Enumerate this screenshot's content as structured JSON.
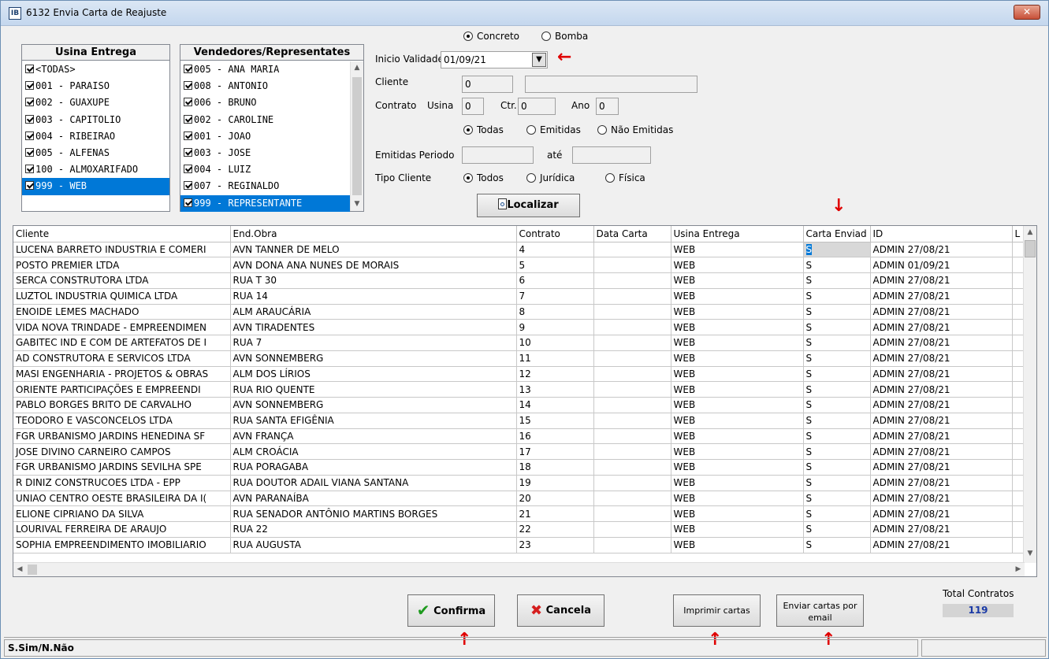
{
  "window": {
    "title": "6132 Envia Carta de Reajuste",
    "icon_text": "IB",
    "close_label": "✕"
  },
  "usina_panel": {
    "header": "Usina Entrega",
    "items": [
      {
        "label": "<TODAS>",
        "checked": true
      },
      {
        "label": "001 - PARAISO",
        "checked": true
      },
      {
        "label": "002 - GUAXUPE",
        "checked": true
      },
      {
        "label": "003 - CAPITOLIO",
        "checked": true
      },
      {
        "label": "004 - RIBEIRAO",
        "checked": true
      },
      {
        "label": "005 - ALFENAS",
        "checked": true
      },
      {
        "label": "100 - ALMOXARIFADO",
        "checked": true
      },
      {
        "label": "999 - WEB",
        "checked": true,
        "selected": true
      }
    ]
  },
  "vendedores_panel": {
    "header": "Vendedores/Representates",
    "items": [
      {
        "label": "005 - ANA MARIA",
        "checked": true
      },
      {
        "label": "008 - ANTONIO",
        "checked": true
      },
      {
        "label": "006 - BRUNO",
        "checked": true
      },
      {
        "label": "002 - CAROLINE",
        "checked": true
      },
      {
        "label": "001 - JOAO",
        "checked": true
      },
      {
        "label": "003 - JOSE",
        "checked": true
      },
      {
        "label": "004 - LUIZ",
        "checked": true
      },
      {
        "label": "007 - REGINALDO",
        "checked": true
      },
      {
        "label": "999 - REPRESENTANTE",
        "checked": true,
        "selected": true
      }
    ]
  },
  "filters": {
    "tipo": {
      "concreto": "Concreto",
      "bomba": "Bomba",
      "selected": "Concreto"
    },
    "inicio_label": "Inicio Validade",
    "inicio_value": "01/09/21",
    "cliente_label": "Cliente",
    "cliente_code": "0",
    "cliente_name": "",
    "contrato_label": "Contrato",
    "usina_label": "Usina",
    "usina_value": "0",
    "ctr_label": "Ctr.",
    "ctr_value": "0",
    "ano_label": "Ano",
    "ano_value": "0",
    "emissao": {
      "todas": "Todas",
      "emitidas": "Emitidas",
      "nao": "Não Emitidas",
      "selected": "Todas"
    },
    "periodo_label": "Emitidas Periodo",
    "ate_label": "até",
    "periodo_from": "",
    "periodo_to": "",
    "tipo_cliente_label": "Tipo Cliente",
    "tipo_cliente": {
      "todos": "Todos",
      "juridica": "Jurídica",
      "fisica": "Física",
      "selected": "Todos"
    },
    "localizar_label": "Localizar"
  },
  "grid": {
    "columns": [
      "Cliente",
      "End.Obra",
      "Contrato",
      "Data Carta",
      "Usina Entrega",
      "Carta Enviad",
      "ID",
      "L"
    ],
    "rows": [
      [
        "LUCENA BARRETO INDUSTRIA E COMERI",
        "AVN TANNER DE MELO",
        "4",
        "",
        "WEB",
        "S",
        "ADMIN 27/08/21"
      ],
      [
        "POSTO PREMIER LTDA",
        "AVN DONA ANA NUNES DE MORAIS",
        "5",
        "",
        "WEB",
        "S",
        "ADMIN 01/09/21"
      ],
      [
        "SERCA CONSTRUTORA LTDA",
        "RUA T 30",
        "6",
        "",
        "WEB",
        "S",
        "ADMIN 27/08/21"
      ],
      [
        "LUZTOL INDUSTRIA QUIMICA LTDA",
        "RUA 14",
        "7",
        "",
        "WEB",
        "S",
        "ADMIN 27/08/21"
      ],
      [
        "ENOIDE LEMES MACHADO",
        "ALM ARAUCÁRIA",
        "8",
        "",
        "WEB",
        "S",
        "ADMIN 27/08/21"
      ],
      [
        "VIDA NOVA TRINDADE - EMPREENDIMEN",
        "AVN TIRADENTES",
        "9",
        "",
        "WEB",
        "S",
        "ADMIN 27/08/21"
      ],
      [
        "GABITEC IND E COM DE ARTEFATOS DE I",
        "RUA 7",
        "10",
        "",
        "WEB",
        "S",
        "ADMIN 27/08/21"
      ],
      [
        "AD CONSTRUTORA E SERVICOS LTDA",
        "AVN SONNEMBERG",
        "11",
        "",
        "WEB",
        "S",
        "ADMIN 27/08/21"
      ],
      [
        "MASI ENGENHARIA - PROJETOS & OBRAS",
        "ALM DOS LÍRIOS",
        "12",
        "",
        "WEB",
        "S",
        "ADMIN 27/08/21"
      ],
      [
        "ORIENTE PARTICIPAÇÕES E EMPREENDI",
        "RUA RIO QUENTE",
        "13",
        "",
        "WEB",
        "S",
        "ADMIN 27/08/21"
      ],
      [
        "PABLO BORGES BRITO DE CARVALHO",
        "AVN SONNEMBERG",
        "14",
        "",
        "WEB",
        "S",
        "ADMIN 27/08/21"
      ],
      [
        "TEODORO E VASCONCELOS LTDA",
        "RUA SANTA EFIGÊNIA",
        "15",
        "",
        "WEB",
        "S",
        "ADMIN 27/08/21"
      ],
      [
        "FGR URBANISMO JARDINS HENEDINA SF",
        "AVN FRANÇA",
        "16",
        "",
        "WEB",
        "S",
        "ADMIN 27/08/21"
      ],
      [
        "JOSE DIVINO CARNEIRO CAMPOS",
        "ALM CROÁCIA",
        "17",
        "",
        "WEB",
        "S",
        "ADMIN 27/08/21"
      ],
      [
        "FGR URBANISMO JARDINS SEVILHA SPE",
        "RUA PORAGABA",
        "18",
        "",
        "WEB",
        "S",
        "ADMIN 27/08/21"
      ],
      [
        "R DINIZ CONSTRUCOES LTDA - EPP",
        "RUA DOUTOR ADAIL VIANA SANTANA",
        "19",
        "",
        "WEB",
        "S",
        "ADMIN 27/08/21"
      ],
      [
        "UNIAO CENTRO OESTE BRASILEIRA DA I(",
        "AVN PARANAÍBA",
        "20",
        "",
        "WEB",
        "S",
        "ADMIN 27/08/21"
      ],
      [
        "ELIONE CIPRIANO DA SILVA",
        "RUA SENADOR ANTÔNIO MARTINS BORGES",
        "21",
        "",
        "WEB",
        "S",
        "ADMIN 27/08/21"
      ],
      [
        "LOURIVAL FERREIRA DE ARAUJO",
        "RUA 22",
        "22",
        "",
        "WEB",
        "S",
        "ADMIN 27/08/21"
      ],
      [
        "SOPHIA EMPREENDIMENTO IMOBILIARIO",
        "RUA AUGUSTA",
        "23",
        "",
        "WEB",
        "S",
        "ADMIN 27/08/21"
      ]
    ]
  },
  "buttons": {
    "confirma": "Confirma",
    "cancela": "Cancela",
    "imprimir": "Imprimir cartas",
    "enviar": "Enviar cartas por email"
  },
  "total": {
    "label": "Total Contratos",
    "value": "119"
  },
  "status": {
    "hint": "S.Sim/N.Não"
  },
  "colors": {
    "selection": "#0078d7",
    "arrow": "#e00000",
    "total_value": "#1a3aa6"
  }
}
